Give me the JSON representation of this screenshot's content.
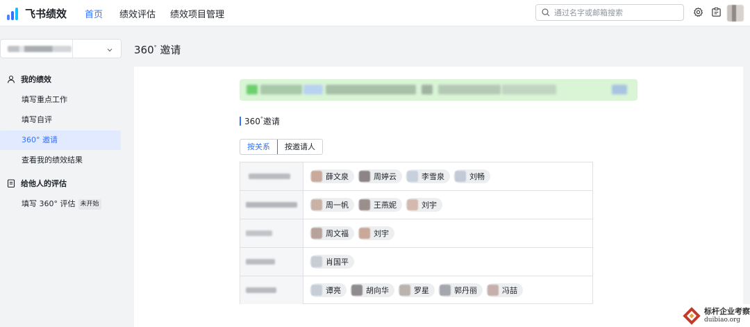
{
  "app": {
    "name": "飞书绩效"
  },
  "nav": [
    {
      "label": "首页",
      "active": true
    },
    {
      "label": "绩效评估",
      "active": false
    },
    {
      "label": "绩效项目管理",
      "active": false
    }
  ],
  "search": {
    "placeholder": "通过名字或邮箱搜索"
  },
  "sidebar": {
    "section_mine": "我的绩效",
    "items_mine": [
      "填写重点工作",
      "填写自评",
      "360° 邀请",
      "查看我的绩效结果"
    ],
    "section_others": "给他人的评估",
    "item_others": "填写 360° 评估",
    "item_others_badge": "未开始"
  },
  "main": {
    "title_main": "360",
    "title_rest": "邀请",
    "section_main": "360",
    "section_rest": "邀请",
    "tabs": [
      "按关系",
      "按邀请人"
    ]
  },
  "table": {
    "rows": [
      {
        "people": [
          "薛文泉",
          "周婷云",
          "李雪泉",
          "刘畅"
        ]
      },
      {
        "people": [
          "周一帆",
          "王燕妮",
          "刘宇"
        ]
      },
      {
        "people": [
          "周文福",
          "刘宇"
        ]
      },
      {
        "people": [
          "肖国平"
        ]
      },
      {
        "people": [
          "谭亮",
          "胡向华",
          "罗星",
          "郭丹丽",
          "冯喆"
        ]
      }
    ]
  },
  "watermark": {
    "line1": "标杆企业考察",
    "line2": "duibiao.org"
  },
  "colors": {
    "accent": "#3370ff",
    "banner": "#d9f5d6"
  }
}
